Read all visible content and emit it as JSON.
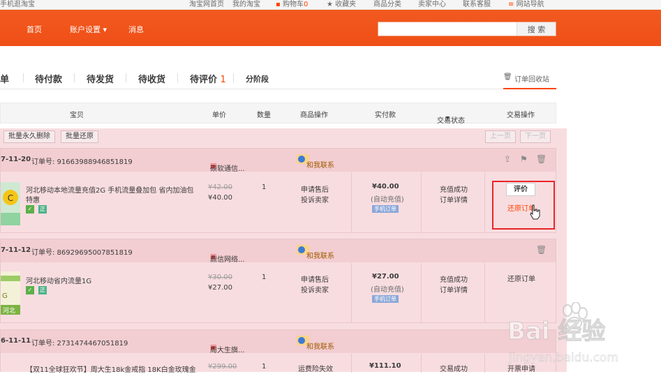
{
  "topbar": {
    "mobile": "手机逛淘宝",
    "home": "淘宝网首页",
    "my": "我的淘宝",
    "cart_label": "购物车",
    "cart_count": "0",
    "favorites": "收藏夹",
    "categories": "商品分类",
    "seller": "卖家中心",
    "service": "联系客服",
    "sitemap": "网站导航"
  },
  "nav": {
    "home": "首页",
    "account": "账户设置 ▾",
    "messages": "消息",
    "search_placeholder": "",
    "search_button": "搜 索"
  },
  "tabs": {
    "all": "单",
    "pay": "待付款",
    "ship": "待发货",
    "receive": "待收货",
    "review": "待评价",
    "review_count": "1",
    "installment": "分阶段",
    "recycle": "订单回收站"
  },
  "table_head": {
    "item": "宝贝",
    "price": "单价",
    "qty": "数量",
    "ops": "商品操作",
    "paid": "实付款",
    "status": "交易状态",
    "action": "交易操作"
  },
  "batch": {
    "delete": "批量永久删除",
    "restore": "批量还原",
    "prev": "上一页",
    "next": "下一页"
  },
  "orders": [
    {
      "date": "7-11-20",
      "order_no": "订单号: 91663988946851819",
      "shop": "硕软通信...",
      "contact": "和我联系",
      "title_line1": "河北移动本地流量充值2G 手机流量叠加包 省内加油包",
      "title_line2": "特惠",
      "orig_price": "¥42.00",
      "price": "¥40.00",
      "qty": "1",
      "op1": "申请售后",
      "op2": "投诉卖家",
      "paid": "¥40.00",
      "paid_note": "(自动充值)",
      "paid_tag": "手机订单",
      "status1": "充值成功",
      "status2": "订单详情",
      "action1": "评价",
      "action2": "还原订单"
    },
    {
      "date": "7-11-12",
      "order_no": "订单号: 86929695007851819",
      "shop": "鼎信网络...",
      "contact": "和我联系",
      "title_line1": "河北移动省内流量1G",
      "title_line2": "",
      "orig_price": "¥30.00",
      "price": "¥27.00",
      "qty": "1",
      "op1": "申请售后",
      "op2": "投诉卖家",
      "paid": "¥27.00",
      "paid_note": "(自动充值)",
      "paid_tag": "手机订单",
      "status1": "充值成功",
      "status2": "订单详情",
      "action1": "还原订单",
      "thumb_text": "河北"
    },
    {
      "date": "6-11-11",
      "order_no": "订单号: 2731474467051819",
      "shop": "周大生旗...",
      "contact": "和我联系",
      "title_line1": "【双11全球狂欢节】周大生18k金戒指 18K白金玫瑰金",
      "orig_price": "¥299.00",
      "qty": "1",
      "op1": "运费险失效",
      "paid": "¥111.10",
      "status1": "交易成功",
      "action1": "开票申请"
    }
  ],
  "watermark": {
    "brand": "Bai 经验",
    "url": "jingyan.baidu.com"
  },
  "colors": {
    "accent": "#ef5219",
    "highlight": "#e8262a",
    "pink": "#f8dde0"
  }
}
